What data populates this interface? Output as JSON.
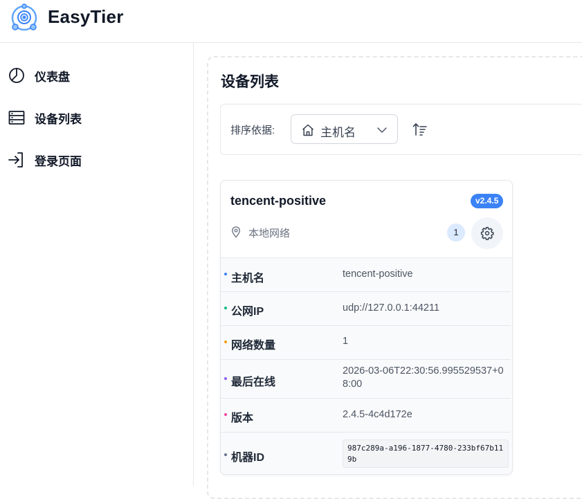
{
  "app": {
    "title": "EasyTier"
  },
  "sidebar": {
    "items": [
      {
        "label": "仪表盘",
        "icon": "pie-chart-icon"
      },
      {
        "label": "设备列表",
        "icon": "server-list-icon"
      },
      {
        "label": "登录页面",
        "icon": "login-icon"
      }
    ]
  },
  "main": {
    "title": "设备列表",
    "sort": {
      "label": "排序依据:",
      "selected": "主机名",
      "icon": "home-icon"
    }
  },
  "device": {
    "hostname": "tencent-positive",
    "version_badge": "v2.4.5",
    "network": "本地网络",
    "network_count": "1",
    "colors": {
      "badge": "#3b82f6"
    },
    "info": [
      {
        "key": "主机名",
        "value": "tencent-positive",
        "dot_color": "#3b82f6"
      },
      {
        "key": "公网IP",
        "value": "udp://127.0.0.1:44211",
        "dot_color": "#10b981"
      },
      {
        "key": "网络数量",
        "value": "1",
        "dot_color": "#f59e0b"
      },
      {
        "key": "最后在线",
        "value": "2026-03-06T22:30:56.995529537+08:00",
        "dot_color": "#8b5cf6"
      },
      {
        "key": "版本",
        "value": "2.4.5-4c4d172e",
        "dot_color": "#ec4899"
      },
      {
        "key": "机器ID",
        "value": "987c289a-a196-1877-4780-233bf67b119b",
        "dot_color": "#64748b"
      }
    ]
  }
}
